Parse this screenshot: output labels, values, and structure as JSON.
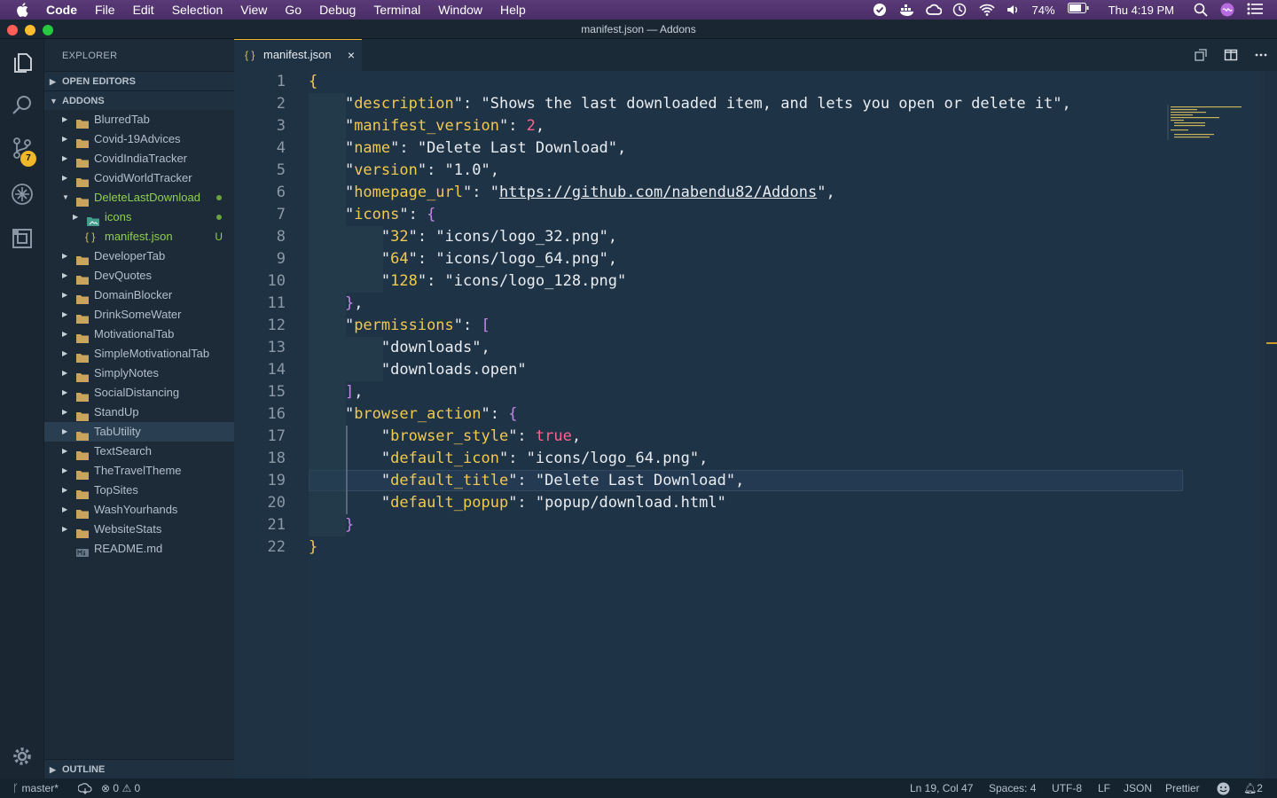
{
  "menubar": {
    "items": [
      "Code",
      "File",
      "Edit",
      "Selection",
      "View",
      "Go",
      "Debug",
      "Terminal",
      "Window",
      "Help"
    ],
    "battery": "74%",
    "clock": "Thu 4:19 PM"
  },
  "window": {
    "title": "manifest.json — Addons"
  },
  "explorer": {
    "title": "EXPLORER",
    "open_editors": "OPEN EDITORS",
    "root": "ADDONS",
    "outline": "OUTLINE",
    "items": [
      {
        "label": "BlurredTab"
      },
      {
        "label": "Covid-19Advices"
      },
      {
        "label": "CovidIndiaTracker"
      },
      {
        "label": "CovidWorldTracker"
      },
      {
        "label": "DeleteLastDownload"
      },
      {
        "label": "icons"
      },
      {
        "label": "manifest.json",
        "status": "U"
      },
      {
        "label": "DeveloperTab"
      },
      {
        "label": "DevQuotes"
      },
      {
        "label": "DomainBlocker"
      },
      {
        "label": "DrinkSomeWater"
      },
      {
        "label": "MotivationalTab"
      },
      {
        "label": "SimpleMotivationalTab"
      },
      {
        "label": "SimplyNotes"
      },
      {
        "label": "SocialDistancing"
      },
      {
        "label": "StandUp"
      },
      {
        "label": "TabUtility"
      },
      {
        "label": "TextSearch"
      },
      {
        "label": "TheTravelTheme"
      },
      {
        "label": "TopSites"
      },
      {
        "label": "WashYourhands"
      },
      {
        "label": "WebsiteStats"
      },
      {
        "label": "README.md"
      }
    ]
  },
  "activity": {
    "scm_badge": "7"
  },
  "tab": {
    "label": "manifest.json",
    "icon": "{ }"
  },
  "code": {
    "line_numbers": [
      "1",
      "2",
      "3",
      "4",
      "5",
      "6",
      "7",
      "8",
      "9",
      "10",
      "11",
      "12",
      "13",
      "14",
      "15",
      "16",
      "17",
      "18",
      "19",
      "20",
      "21",
      "22"
    ],
    "l2_k": "description",
    "l2_v": "Shows the last downloaded item, and lets you open or delete it",
    "l3_k": "manifest_version",
    "l3_v": "2",
    "l4_k": "name",
    "l4_v": "Delete Last Download",
    "l5_k": "version",
    "l5_v": "1.0",
    "l6_k": "homepage_url",
    "l6_v": "https://github.com/nabendu82/Addons",
    "l7_k": "icons",
    "l8_k": "32",
    "l8_v": "icons/logo_32.png",
    "l9_k": "64",
    "l9_v": "icons/logo_64.png",
    "l10_k": "128",
    "l10_v": "icons/logo_128.png",
    "l12_k": "permissions",
    "l13_v": "downloads",
    "l14_v": "downloads.open",
    "l16_k": "browser_action",
    "l17_k": "browser_style",
    "l17_v": "true",
    "l18_k": "default_icon",
    "l18_v": "icons/logo_64.png",
    "l19_k": "default_title",
    "l19_v": "Delete Last Download",
    "l20_k": "default_popup",
    "l20_v": "popup/download.html"
  },
  "status": {
    "branch": "master*",
    "errors": "0",
    "warnings": "0",
    "position": "Ln 19, Col 47",
    "spaces": "Spaces: 4",
    "encoding": "UTF-8",
    "eol": "LF",
    "language": "JSON",
    "formatter": "Prettier",
    "notifications": "2"
  },
  "colors": {
    "accent": "#f0b829",
    "key": "#f2c94c",
    "number": "#ff628c",
    "bracket": "#c586ea",
    "git_added": "#8fcf4f"
  }
}
